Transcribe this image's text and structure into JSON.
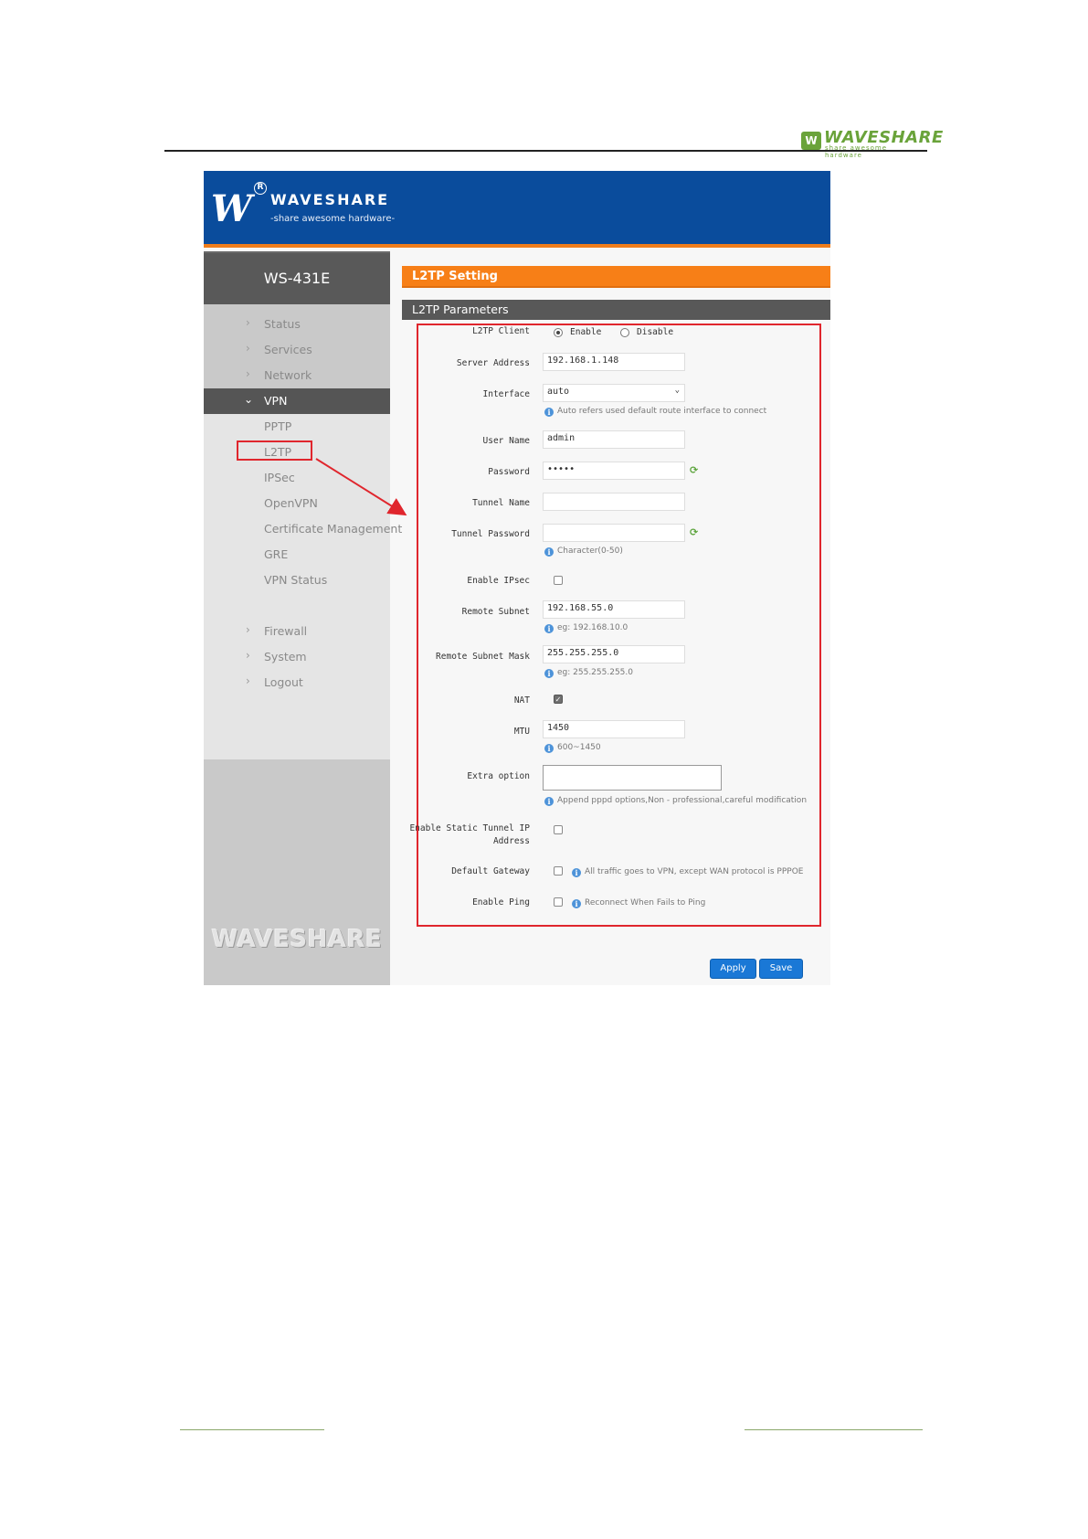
{
  "doc_header": {
    "logo_text": "WAVESHARE",
    "logo_sub": "share awesome hardware"
  },
  "header": {
    "brand_name": "WAVESHARE",
    "tagline": "-share awesome hardware-"
  },
  "sidebar": {
    "model": "WS-431E",
    "items": [
      {
        "label": "Status"
      },
      {
        "label": "Services"
      },
      {
        "label": "Network"
      },
      {
        "label": "VPN"
      },
      {
        "label": "Firewall"
      },
      {
        "label": "System"
      },
      {
        "label": "Logout"
      }
    ],
    "vpn_sub": [
      {
        "label": "PPTP"
      },
      {
        "label": "L2TP"
      },
      {
        "label": "IPSec"
      },
      {
        "label": "OpenVPN"
      },
      {
        "label": "Certificate Management"
      },
      {
        "label": "GRE"
      },
      {
        "label": "VPN Status"
      }
    ],
    "watermark": "WAVESHARE"
  },
  "main": {
    "section_title": "L2TP Setting",
    "params_title": "L2TP Parameters",
    "l2tp_client": {
      "label": "L2TP Client",
      "enable": "Enable",
      "disable": "Disable",
      "selected": "Enable"
    },
    "server_address": {
      "label": "Server Address",
      "value": "192.168.1.148"
    },
    "interface": {
      "label": "Interface",
      "value": "auto",
      "hint": "Auto refers used default route interface to connect"
    },
    "user_name": {
      "label": "User Name",
      "value": "admin"
    },
    "password": {
      "label": "Password",
      "value": "•••••"
    },
    "tunnel_name": {
      "label": "Tunnel Name",
      "value": ""
    },
    "tunnel_password": {
      "label": "Tunnel Password",
      "value": "",
      "hint": "Character(0-50)"
    },
    "enable_ipsec": {
      "label": "Enable IPsec",
      "checked": false
    },
    "remote_subnet": {
      "label": "Remote Subnet",
      "value": "192.168.55.0",
      "hint": "eg: 192.168.10.0"
    },
    "remote_subnet_mask": {
      "label": "Remote Subnet Mask",
      "value": "255.255.255.0",
      "hint": "eg: 255.255.255.0"
    },
    "nat": {
      "label": "NAT",
      "checked": true
    },
    "mtu": {
      "label": "MTU",
      "value": "1450",
      "hint": "600~1450"
    },
    "extra_option": {
      "label": "Extra option",
      "value": "",
      "hint": "Append pppd options,Non - professional,careful modification"
    },
    "static_tunnel_ip": {
      "label_line1": "Enable Static Tunnel IP",
      "label_line2": "Address",
      "checked": false
    },
    "default_gateway": {
      "label": "Default Gateway",
      "checked": false,
      "hint": "All traffic goes to VPN, except WAN protocol is PPPOE"
    },
    "enable_ping": {
      "label": "Enable Ping",
      "checked": false,
      "hint": "Reconnect When Fails to Ping"
    },
    "apply_label": "Apply",
    "save_label": "Save"
  },
  "colors": {
    "header_blue": "#0a4c9c",
    "accent_orange": "#f77f17",
    "annotation_red": "#e0262d",
    "button_blue": "#1a78d6"
  }
}
